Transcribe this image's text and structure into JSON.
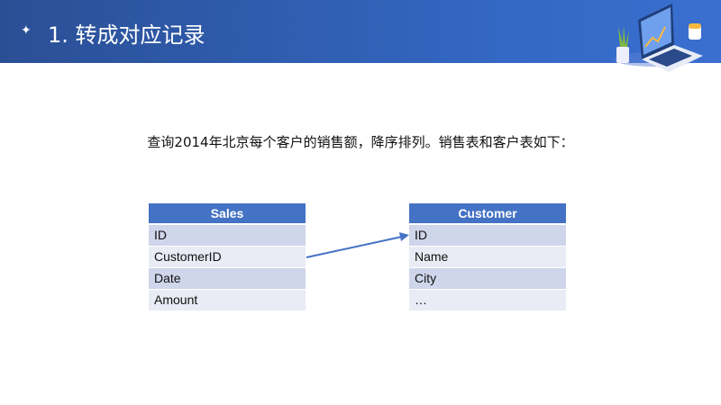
{
  "header": {
    "title": "1. 转成对应记录",
    "bullet": "✦"
  },
  "description": "查询2014年北京每个客户的销售额，降序排列。销售表和客户表如下：",
  "sales_table": {
    "title": "Sales",
    "rows": [
      "ID",
      "CustomerID",
      "Date",
      "Amount"
    ]
  },
  "customer_table": {
    "title": "Customer",
    "rows": [
      "ID",
      "Name",
      "City",
      "…"
    ]
  },
  "colors": {
    "header": "#3368c4",
    "table_header": "#4472c4",
    "row_dark": "#cfd5ea",
    "row_light": "#e9ebf5",
    "arrow": "#4472c4"
  }
}
